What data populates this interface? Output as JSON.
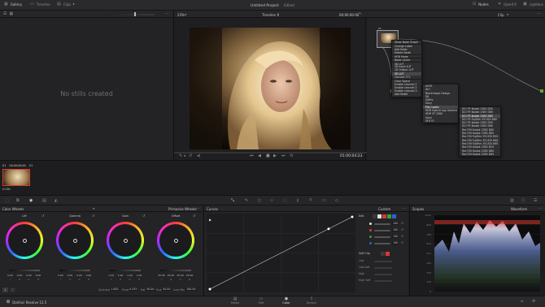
{
  "top_bar": {
    "gallery": "Gallery",
    "timeline": "Timeline",
    "clips": "Clips",
    "project_title": "Untitled Project",
    "edited": "Edited",
    "nodes": "Nodes",
    "openfx": "OpenFX",
    "lightbox": "Lightbox"
  },
  "gallery": {
    "placeholder": "No stills created"
  },
  "viewer": {
    "zoom": "23%",
    "timeline_name": "Timeline 1",
    "timecode_left": "00:00:00:00",
    "timecode_right": "01:00:04:23"
  },
  "node_editor": {
    "mode": "Clip",
    "node_label": "01"
  },
  "context_menu": {
    "items": [
      {
        "label": "Show Node Graph",
        "sep": false
      },
      {
        "label": "Change Label",
        "sep": true
      },
      {
        "label": "Add Node",
        "sep": false
      },
      {
        "label": "Delete Node",
        "sep": false
      },
      {
        "label": "HDR Mode",
        "sep": true
      },
      {
        "label": "Node Cache",
        "sep": true
      },
      {
        "label": "3D LUT",
        "sep": true
      },
      {
        "label": "1D Input LUT",
        "sep": false
      },
      {
        "label": "1D Output LUT",
        "sep": false
      },
      {
        "label": "3D LUT",
        "sep": false,
        "highlight": true
      },
      {
        "label": "Convert CTL",
        "sep": false
      },
      {
        "label": "Color Space",
        "sep": true
      },
      {
        "label": "Enable channel 1",
        "sep": false
      },
      {
        "label": "Enable channel 2",
        "sep": false
      },
      {
        "label": "Enable channel 3",
        "sep": false
      },
      {
        "label": "Add Matte",
        "sep": false
      }
    ],
    "sub1": [
      "ACES",
      "Arri",
      "Blackmagic Design",
      "DJI",
      "GoPro",
      "Sony",
      "Film Looks",
      "HDR Hybrid Log-Gamma",
      "HDR ST 2084",
      "Sony",
      "VFX IO"
    ],
    "sub1_hl": 6,
    "sub2": [
      "DCI P3 Kodak 2383 D55",
      "DCI P3 Kodak 2383 D60",
      "DCI P3 Kodak 2383 D65",
      "DCI P3 Fujifilm 3513DI D60",
      "DCI P3 Kodak 2383 D55",
      "DCI P3 Kodak 2383 D60",
      "Rec709 Kodak 2383 D60",
      "Rec709 Kodak 2383 D65",
      "Rec709 Fujifilm 3513DI D55",
      "Rec709 Fujifilm 3513DI D60",
      "Rec709 Fujifilm 3513DI D65",
      "Rec709 Kodak 2383 D55",
      "Rec709 Kodak 2383 D60",
      "Rec709 Kodak 2383 D65"
    ],
    "sub2_hl": 2
  },
  "thumbnail": {
    "index": "01",
    "timecode": "00:00:00:00",
    "codec": "H.264",
    "clip_label": "V1"
  },
  "color_wheels": {
    "title": "Color Wheels",
    "mode": "Primaries Wheels",
    "wheels": [
      {
        "name": "Lift",
        "values": [
          "0.00",
          "0.00",
          "0.00",
          "0.00"
        ]
      },
      {
        "name": "Gamma",
        "values": [
          "0.00",
          "0.00",
          "0.00",
          "0.00"
        ]
      },
      {
        "name": "Gain",
        "values": [
          "1.00",
          "1.00",
          "1.00",
          "1.00"
        ]
      },
      {
        "name": "Offset",
        "values": [
          "25.00",
          "25.00",
          "25.00",
          "25.00"
        ]
      }
    ],
    "channel_labels": [
      "Y",
      "R",
      "G",
      "B"
    ],
    "contrast_label": "Contrast",
    "contrast": "1.000",
    "pivot_label": "Pivot",
    "pivot": "0.435",
    "sat_label": "Sat",
    "sat": "50.00",
    "hue_label": "Hue",
    "hue": "50.00",
    "lum_mix_label": "Lum Mix",
    "lum_mix": "100.00",
    "page_buttons": [
      "1",
      "2"
    ]
  },
  "curves": {
    "title": "Curves",
    "mode": "Custom",
    "edit_label": "Edit",
    "intensities": [
      "100",
      "100",
      "100",
      "100"
    ],
    "soft_clip_label": "Soft Clip",
    "soft_rows": [
      "Low",
      "Low Soft",
      "High",
      "High Soft"
    ]
  },
  "scopes": {
    "title": "Scopes",
    "mode": "Waveform",
    "ticks": [
      "1023",
      "896",
      "768",
      "640",
      "512",
      "384",
      "256",
      "128",
      "0"
    ]
  },
  "bottom_bar": {
    "app_name": "DaVinci Resolve 12.5",
    "pages": [
      "Media",
      "Edit",
      "Color",
      "Deliver"
    ],
    "active_page": "Color"
  },
  "colors": {
    "accent": "#d9392f",
    "active_nav": "#e0e0e0",
    "node_green": "#6aa13a"
  }
}
